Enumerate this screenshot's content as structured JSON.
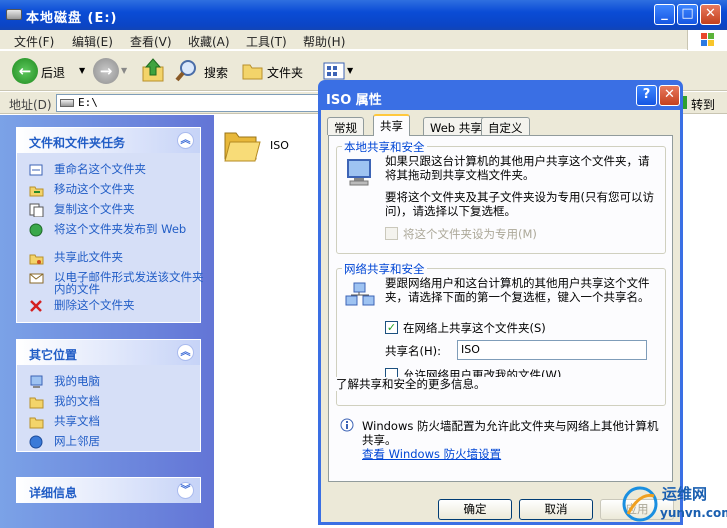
{
  "window": {
    "title": "本地磁盘 (E:)"
  },
  "menu": [
    "文件(F)",
    "编辑(E)",
    "查看(V)",
    "收藏(A)",
    "工具(T)",
    "帮助(H)"
  ],
  "toolbar": {
    "back": "后退",
    "search": "搜索",
    "folders": "文件夹"
  },
  "address": {
    "label": "地址(D)",
    "value": "E:\\",
    "go": "转到"
  },
  "tasks_panel": {
    "title": "文件和文件夹任务",
    "items": [
      "重命名这个文件夹",
      "移动这个文件夹",
      "复制这个文件夹",
      "将这个文件夹发布到 Web",
      "共享此文件夹",
      "以电子邮件形式发送该文件夹内的文件",
      "删除这个文件夹"
    ]
  },
  "places_panel": {
    "title": "其它位置",
    "items": [
      "我的电脑",
      "我的文档",
      "共享文档",
      "网上邻居"
    ]
  },
  "details_panel": {
    "title": "详细信息"
  },
  "folder": {
    "name": "ISO"
  },
  "dialog": {
    "title": "ISO 属性",
    "tabs": [
      "常规",
      "共享",
      "Web 共享",
      "自定义"
    ],
    "selected_tab": "共享",
    "local": {
      "group_title": "本地共享和安全",
      "text1": "如果只跟这台计算机的其他用户共享这个文件夹，请将其拖动到共享文档文件夹。",
      "text2": "要将这个文件夹及其子文件夹设为专用(只有您可以访问)，请选择以下复选框。",
      "private_checkbox": "将这个文件夹设为专用(M)",
      "private_checked": false
    },
    "network": {
      "group_title": "网络共享和安全",
      "text": "要跟网络用户和这台计算机的其他用户共享这个文件夹，请选择下面的第一个复选框，键入一个共享名。",
      "share_checkbox": "在网络上共享这个文件夹(S)",
      "share_checked": true,
      "share_name_label": "共享名(H):",
      "share_name_value": "ISO",
      "allow_change_checkbox": "允许网络用户更改我的文件(W)",
      "allow_change_checked": false,
      "learn_more": "了解共享和安全的更多信息。"
    },
    "firewall": {
      "text": "Windows 防火墙配置为允许此文件夹与网络上其他计算机共享。",
      "link": "查看 Windows 防火墙设置"
    },
    "buttons": {
      "ok": "确定",
      "cancel": "取消",
      "apply": "应用"
    }
  },
  "watermark": {
    "brand": "运维网",
    "url": "yunvn.com"
  }
}
